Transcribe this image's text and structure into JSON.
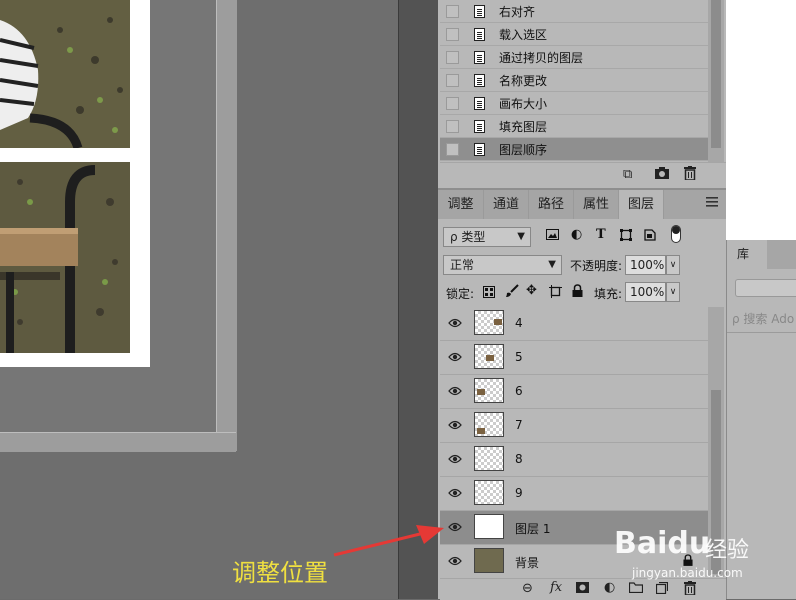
{
  "history": {
    "items": [
      {
        "label": "右对齐",
        "selected": false
      },
      {
        "label": "载入选区",
        "selected": false
      },
      {
        "label": "通过拷贝的图层",
        "selected": false
      },
      {
        "label": "名称更改",
        "selected": false
      },
      {
        "label": "画布大小",
        "selected": false
      },
      {
        "label": "填充图层",
        "selected": false
      },
      {
        "label": "图层顺序",
        "selected": true
      }
    ],
    "footer_icons": [
      "new-document-from-state-icon",
      "camera-icon",
      "trash-icon"
    ]
  },
  "tabs": [
    {
      "label": "调整",
      "active": false
    },
    {
      "label": "通道",
      "active": false
    },
    {
      "label": "路径",
      "active": false
    },
    {
      "label": "属性",
      "active": false
    },
    {
      "label": "图层",
      "active": true
    }
  ],
  "filter": {
    "kind_label": "ρ 类型",
    "icons": [
      "image-filter-icon",
      "adjustment-filter-icon",
      "type-filter-icon",
      "shape-filter-icon",
      "smart-object-filter-icon",
      "filter-toggle-icon"
    ]
  },
  "blend": {
    "mode": "正常",
    "opacity_label": "不透明度:",
    "opacity_value": "100%"
  },
  "lock": {
    "label": "锁定:",
    "fill_label": "填充:",
    "fill_value": "100%"
  },
  "layers": [
    {
      "name": "4",
      "thumb": "transparent",
      "visible": true,
      "selected": false
    },
    {
      "name": "5",
      "thumb": "transparent",
      "visible": true,
      "selected": false
    },
    {
      "name": "6",
      "thumb": "transparent",
      "visible": true,
      "selected": false
    },
    {
      "name": "7",
      "thumb": "transparent",
      "visible": true,
      "selected": false
    },
    {
      "name": "8",
      "thumb": "transparent",
      "visible": true,
      "selected": false
    },
    {
      "name": "9",
      "thumb": "transparent",
      "visible": true,
      "selected": false
    },
    {
      "name": "图层 1",
      "thumb": "white",
      "visible": true,
      "selected": true
    },
    {
      "name": "背景",
      "thumb": "photo",
      "visible": true,
      "selected": false
    }
  ],
  "layers_footer_icons": [
    "link-icon",
    "fx-icon",
    "mask-icon",
    "adjustment-icon",
    "group-icon",
    "new-layer-icon",
    "trash-icon"
  ],
  "library": {
    "tab": "库",
    "search_placeholder": "ρ 搜索 Ado"
  },
  "annotation": {
    "text": "调整位置",
    "color": "#f0e040",
    "arrow_color": "#e53935"
  },
  "watermark": {
    "brand": "Baidu",
    "suffix": "经验",
    "url": "jingyan.baidu.com"
  }
}
